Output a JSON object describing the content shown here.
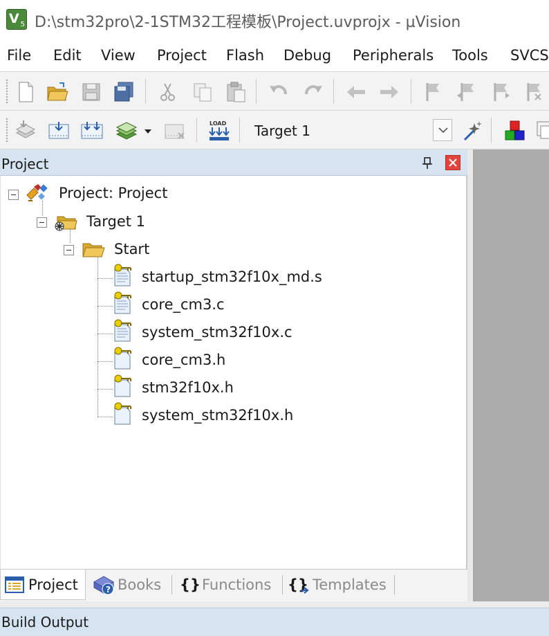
{
  "window": {
    "title": "D:\\stm32pro\\2-1STM32工程模板\\Project.uvprojx - µVision",
    "app_icon_label": "V",
    "app_icon_sub": "5"
  },
  "menu": {
    "items": [
      "File",
      "Edit",
      "View",
      "Project",
      "Flash",
      "Debug",
      "Peripherals",
      "Tools",
      "SVCS"
    ]
  },
  "toolbar1": {
    "icons": [
      "new-file-icon",
      "open-folder-icon",
      "save-icon",
      "save-all-icon",
      "cut-icon",
      "copy-icon",
      "paste-icon",
      "undo-icon",
      "redo-icon",
      "nav-back-icon",
      "nav-forward-icon",
      "bookmark-icon",
      "bookmark-prev-icon",
      "bookmark-next-icon",
      "bookmark-clear-icon"
    ]
  },
  "toolbar2": {
    "icons": [
      "translate-icon",
      "build-icon",
      "rebuild-icon",
      "batch-build-icon",
      "stop-build-icon",
      "download-icon",
      "target-options-icon",
      "manage-components-icon"
    ],
    "load_label": "LOAD",
    "target_select": "Target 1"
  },
  "project_panel": {
    "title": "Project",
    "pin_icon": "pin-icon",
    "close_icon": "close-icon",
    "tree": {
      "root": "Project: Project",
      "target": "Target 1",
      "group": "Start",
      "files": [
        "startup_stm32f10x_md.s",
        "core_cm3.c",
        "system_stm32f10x.c",
        "core_cm3.h",
        "stm32f10x.h",
        "system_stm32f10x.h"
      ]
    }
  },
  "bottom_tabs": {
    "project": "Project",
    "books": "Books",
    "functions_icon": "{}",
    "functions": "Functions",
    "templates_icon": "{}",
    "templates": "Templates"
  },
  "build_output": {
    "title": "Build Output"
  },
  "colors": {
    "panel_header": "#d6e4f2",
    "right_gray": "#ababab",
    "close_red": "#e0443c",
    "folder_yellow": "#f0c040",
    "file_key": "#e8d000"
  }
}
